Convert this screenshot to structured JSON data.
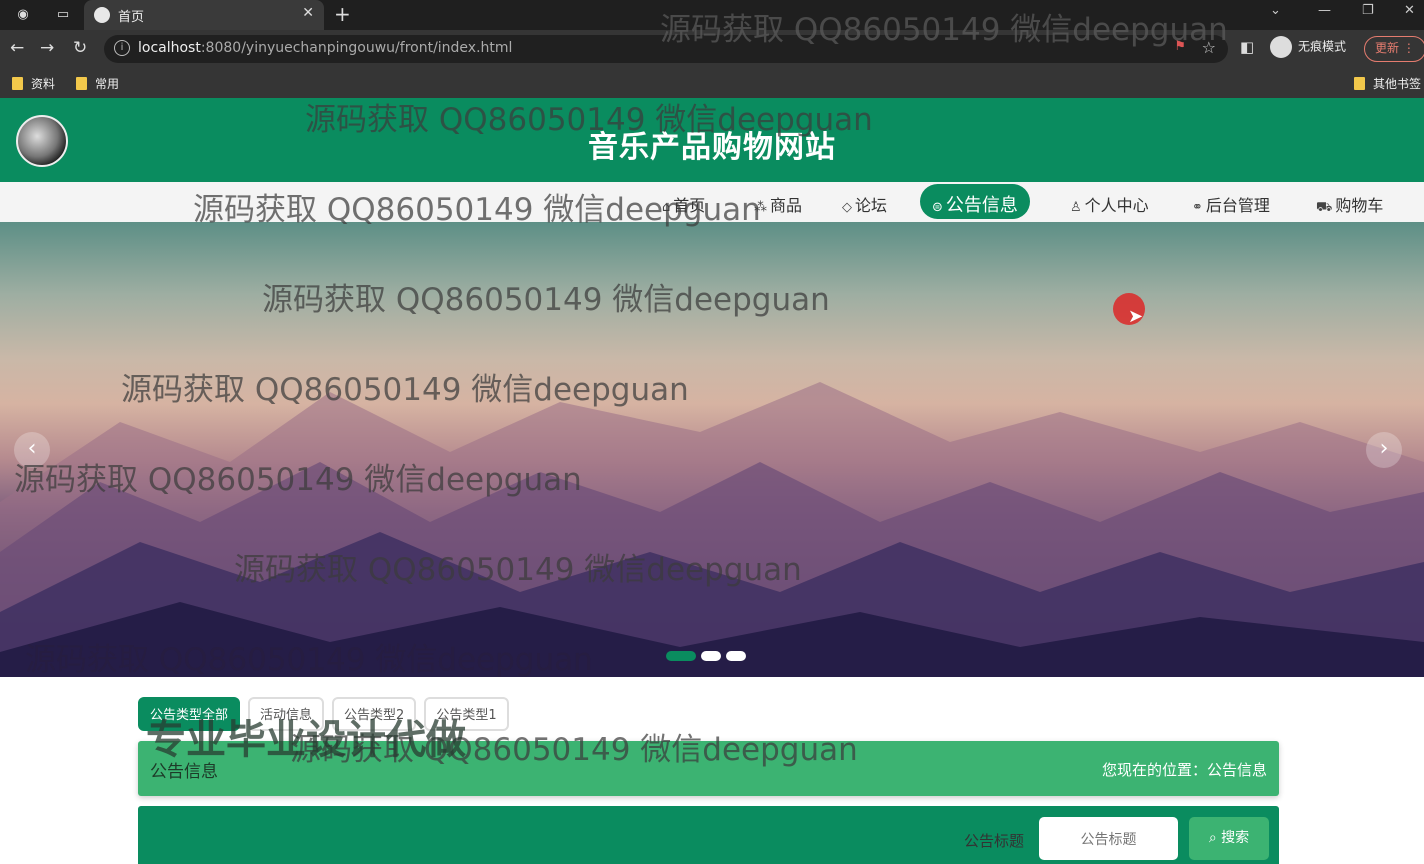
{
  "browser": {
    "tab_title": "首页",
    "url_host": "localhost",
    "url_rest": ":8080/yinyuechanpingouwu/front/index.html",
    "incognito_label": "无痕模式",
    "update_label": "更新",
    "bookmarks": [
      "资料",
      "常用"
    ],
    "bookmarks_right": "其他书签"
  },
  "site": {
    "title": "音乐产品购物网站",
    "nav": [
      {
        "icon": "⌂",
        "label": "首页"
      },
      {
        "icon": "⁂",
        "label": "商品"
      },
      {
        "icon": "◇",
        "label": "论坛"
      },
      {
        "icon": "⊜",
        "label": "公告信息",
        "active": true
      },
      {
        "icon": "♙",
        "label": "个人中心"
      },
      {
        "icon": "⚭",
        "label": "后台管理"
      },
      {
        "icon": "⛟",
        "label": "购物车"
      }
    ]
  },
  "carousel": {
    "slides": 3,
    "active_index": 0
  },
  "filters": [
    "公告类型全部",
    "活动信息",
    "公告类型2",
    "公告类型1"
  ],
  "breadcrumb": {
    "title": "公告信息",
    "position": "您现在的位置：公告信息"
  },
  "search": {
    "label": "公告标题",
    "placeholder": "公告标题",
    "button": "搜索"
  },
  "watermarks": {
    "text": "源码获取 QQ86050149 微信deepguan",
    "big": "专业毕业设计代做"
  },
  "colors": {
    "brand": "#0a8c5f",
    "accent": "#3cb372"
  }
}
